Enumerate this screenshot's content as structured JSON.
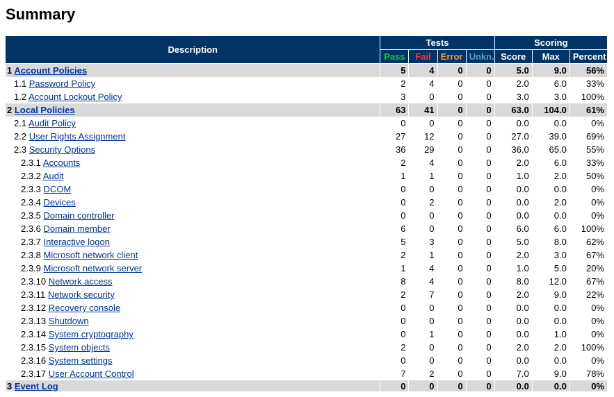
{
  "title": "Summary",
  "columns": {
    "description": "Description",
    "tests": "Tests",
    "scoring": "Scoring",
    "pass": "Pass",
    "fail": "Fail",
    "error": "Error",
    "unkn": "Unkn.",
    "score": "Score",
    "max": "Max",
    "percent": "Percent"
  },
  "rows": [
    {
      "level": 0,
      "group": true,
      "id": "1",
      "label": "Account Policies",
      "link": true,
      "pass": 5,
      "fail": 4,
      "error": 0,
      "unkn": 0,
      "score": "5.0",
      "max": "9.0",
      "percent": "56%"
    },
    {
      "level": 1,
      "group": false,
      "id": "1.1",
      "label": "Password Policy",
      "link": true,
      "pass": 2,
      "fail": 4,
      "error": 0,
      "unkn": 0,
      "score": "2.0",
      "max": "6.0",
      "percent": "33%"
    },
    {
      "level": 1,
      "group": false,
      "id": "1.2",
      "label": "Account Lockout Policy",
      "link": true,
      "pass": 3,
      "fail": 0,
      "error": 0,
      "unkn": 0,
      "score": "3.0",
      "max": "3.0",
      "percent": "100%"
    },
    {
      "level": 0,
      "group": true,
      "id": "2",
      "label": "Local Policies",
      "link": true,
      "pass": 63,
      "fail": 41,
      "error": 0,
      "unkn": 0,
      "score": "63.0",
      "max": "104.0",
      "percent": "61%"
    },
    {
      "level": 1,
      "group": false,
      "id": "2.1",
      "label": "Audit Policy",
      "link": true,
      "pass": 0,
      "fail": 0,
      "error": 0,
      "unkn": 0,
      "score": "0.0",
      "max": "0.0",
      "percent": "0%"
    },
    {
      "level": 1,
      "group": false,
      "id": "2.2",
      "label": "User Rights Assignment",
      "link": true,
      "pass": 27,
      "fail": 12,
      "error": 0,
      "unkn": 0,
      "score": "27.0",
      "max": "39.0",
      "percent": "69%"
    },
    {
      "level": 1,
      "group": false,
      "id": "2.3",
      "label": "Security Options",
      "link": true,
      "pass": 36,
      "fail": 29,
      "error": 0,
      "unkn": 0,
      "score": "36.0",
      "max": "65.0",
      "percent": "55%"
    },
    {
      "level": 2,
      "group": false,
      "id": "2.3.1",
      "label": "Accounts",
      "link": true,
      "pass": 2,
      "fail": 4,
      "error": 0,
      "unkn": 0,
      "score": "2.0",
      "max": "6.0",
      "percent": "33%"
    },
    {
      "level": 2,
      "group": false,
      "id": "2.3.2",
      "label": "Audit",
      "link": true,
      "pass": 1,
      "fail": 1,
      "error": 0,
      "unkn": 0,
      "score": "1.0",
      "max": "2.0",
      "percent": "50%"
    },
    {
      "level": 2,
      "group": false,
      "id": "2.3.3",
      "label": "DCOM",
      "link": true,
      "pass": 0,
      "fail": 0,
      "error": 0,
      "unkn": 0,
      "score": "0.0",
      "max": "0.0",
      "percent": "0%"
    },
    {
      "level": 2,
      "group": false,
      "id": "2.3.4",
      "label": "Devices",
      "link": true,
      "pass": 0,
      "fail": 2,
      "error": 0,
      "unkn": 0,
      "score": "0.0",
      "max": "2.0",
      "percent": "0%"
    },
    {
      "level": 2,
      "group": false,
      "id": "2.3.5",
      "label": "Domain controller",
      "link": true,
      "pass": 0,
      "fail": 0,
      "error": 0,
      "unkn": 0,
      "score": "0.0",
      "max": "0.0",
      "percent": "0%"
    },
    {
      "level": 2,
      "group": false,
      "id": "2.3.6",
      "label": "Domain member",
      "link": true,
      "pass": 6,
      "fail": 0,
      "error": 0,
      "unkn": 0,
      "score": "6.0",
      "max": "6.0",
      "percent": "100%"
    },
    {
      "level": 2,
      "group": false,
      "id": "2.3.7",
      "label": "Interactive logon",
      "link": true,
      "pass": 5,
      "fail": 3,
      "error": 0,
      "unkn": 0,
      "score": "5.0",
      "max": "8.0",
      "percent": "62%"
    },
    {
      "level": 2,
      "group": false,
      "id": "2.3.8",
      "label": "Microsoft network client",
      "link": true,
      "pass": 2,
      "fail": 1,
      "error": 0,
      "unkn": 0,
      "score": "2.0",
      "max": "3.0",
      "percent": "67%"
    },
    {
      "level": 2,
      "group": false,
      "id": "2.3.9",
      "label": "Microsoft network server",
      "link": true,
      "pass": 1,
      "fail": 4,
      "error": 0,
      "unkn": 0,
      "score": "1.0",
      "max": "5.0",
      "percent": "20%"
    },
    {
      "level": 2,
      "group": false,
      "id": "2.3.10",
      "label": "Network access",
      "link": true,
      "pass": 8,
      "fail": 4,
      "error": 0,
      "unkn": 0,
      "score": "8.0",
      "max": "12.0",
      "percent": "67%"
    },
    {
      "level": 2,
      "group": false,
      "id": "2.3.11",
      "label": "Network security",
      "link": true,
      "pass": 2,
      "fail": 7,
      "error": 0,
      "unkn": 0,
      "score": "2.0",
      "max": "9.0",
      "percent": "22%"
    },
    {
      "level": 2,
      "group": false,
      "id": "2.3.12",
      "label": "Recovery console",
      "link": true,
      "pass": 0,
      "fail": 0,
      "error": 0,
      "unkn": 0,
      "score": "0.0",
      "max": "0.0",
      "percent": "0%"
    },
    {
      "level": 2,
      "group": false,
      "id": "2.3.13",
      "label": "Shutdown",
      "link": true,
      "pass": 0,
      "fail": 0,
      "error": 0,
      "unkn": 0,
      "score": "0.0",
      "max": "0.0",
      "percent": "0%"
    },
    {
      "level": 2,
      "group": false,
      "id": "2.3.14",
      "label": "System cryptography",
      "link": true,
      "pass": 0,
      "fail": 1,
      "error": 0,
      "unkn": 0,
      "score": "0.0",
      "max": "1.0",
      "percent": "0%"
    },
    {
      "level": 2,
      "group": false,
      "id": "2.3.15",
      "label": "System objects",
      "link": true,
      "pass": 2,
      "fail": 0,
      "error": 0,
      "unkn": 0,
      "score": "2.0",
      "max": "2.0",
      "percent": "100%"
    },
    {
      "level": 2,
      "group": false,
      "id": "2.3.16",
      "label": "System settings",
      "link": true,
      "pass": 0,
      "fail": 0,
      "error": 0,
      "unkn": 0,
      "score": "0.0",
      "max": "0.0",
      "percent": "0%"
    },
    {
      "level": 2,
      "group": false,
      "id": "2.3.17",
      "label": "User Account Control",
      "link": true,
      "pass": 7,
      "fail": 2,
      "error": 0,
      "unkn": 0,
      "score": "7.0",
      "max": "9.0",
      "percent": "78%"
    },
    {
      "level": 0,
      "group": true,
      "id": "3",
      "label": "Event Log",
      "link": true,
      "pass": 0,
      "fail": 0,
      "error": 0,
      "unkn": 0,
      "score": "0.0",
      "max": "0.0",
      "percent": "0%",
      "cut": true
    }
  ]
}
